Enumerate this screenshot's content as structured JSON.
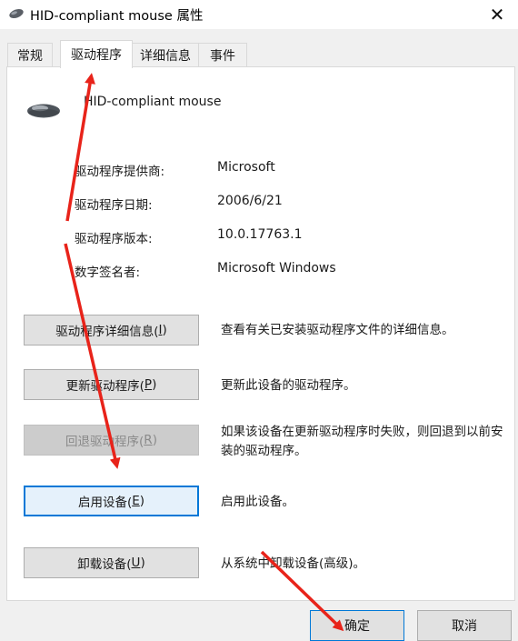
{
  "window": {
    "title": "HID-compliant mouse 属性",
    "title_icon": "mouse-icon",
    "close_glyph": "✕"
  },
  "tabs": [
    {
      "label": "常规",
      "active": false
    },
    {
      "label": "驱动程序",
      "active": true
    },
    {
      "label": "详细信息",
      "active": false
    },
    {
      "label": "事件",
      "active": false
    }
  ],
  "device": {
    "icon": "mouse-icon",
    "name": "HID-compliant mouse"
  },
  "info": [
    {
      "label": "驱动程序提供商:",
      "value": "Microsoft"
    },
    {
      "label": "驱动程序日期:",
      "value": "2006/6/21"
    },
    {
      "label": "驱动程序版本:",
      "value": "10.0.17763.1"
    },
    {
      "label": "数字签名者:",
      "value": "Microsoft Windows"
    }
  ],
  "actions": [
    {
      "label": "驱动程序详细信息(",
      "key": "I",
      "close": ")",
      "description": "查看有关已安装驱动程序文件的详细信息。",
      "enabled": true
    },
    {
      "label": "更新驱动程序(",
      "key": "P",
      "close": ")",
      "description": "更新此设备的驱动程序。",
      "enabled": true
    },
    {
      "label": "回退驱动程序(",
      "key": "R",
      "close": ")",
      "description": "如果该设备在更新驱动程序时失败，则回退到以前安装的驱动程序。",
      "enabled": false
    },
    {
      "label": "启用设备(",
      "key": "E",
      "close": ")",
      "description": "启用此设备。",
      "enabled": true,
      "focused": true
    },
    {
      "label": "卸载设备(",
      "key": "U",
      "close": ")",
      "description": "从系统中卸载设备(高级)。",
      "enabled": true
    }
  ],
  "footer": {
    "ok": "确定",
    "cancel": "取消"
  },
  "colors": {
    "annotation_arrow": "#e8231a",
    "focus_border": "#0078d7"
  }
}
